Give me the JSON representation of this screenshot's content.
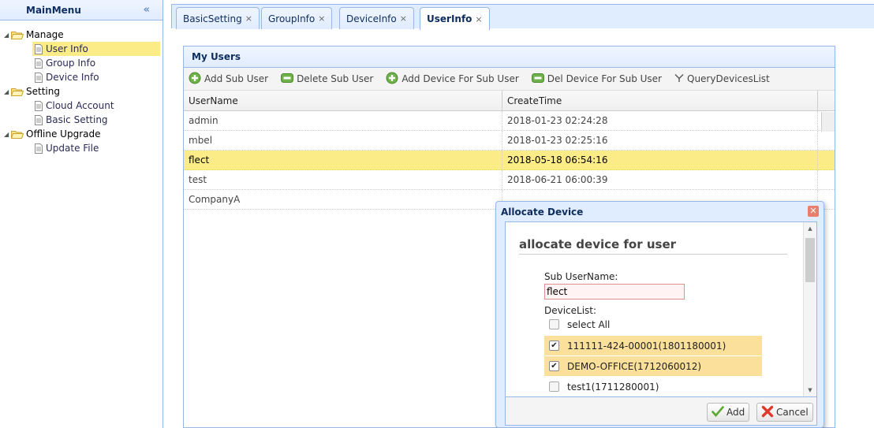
{
  "menu": {
    "title": "MainMenu",
    "collapse_icon": "double-chevron-left-icon",
    "groups": [
      {
        "label": "Manage",
        "items": [
          {
            "label": "User Info",
            "selected": true
          },
          {
            "label": "Group Info"
          },
          {
            "label": "Device Info"
          }
        ]
      },
      {
        "label": "Setting",
        "items": [
          {
            "label": "Cloud Account"
          },
          {
            "label": "Basic Setting"
          }
        ]
      },
      {
        "label": "Offline Upgrade",
        "items": [
          {
            "label": "Update File"
          }
        ]
      }
    ]
  },
  "tabs": [
    {
      "label": "BasicSetting",
      "close": "×"
    },
    {
      "label": "GroupInfo",
      "close": "×"
    },
    {
      "label": "DeviceInfo",
      "close": "×"
    },
    {
      "label": "UserInfo",
      "close": "×",
      "active": true
    }
  ],
  "panel": {
    "title": "My Users",
    "toolbar": {
      "add_sub_user": "Add Sub User",
      "delete_sub_user": "Delete Sub User",
      "add_device": "Add Device For Sub User",
      "del_device": "Del Device For Sub User",
      "query_devices": "QueryDevicesList"
    },
    "columns": [
      "UserName",
      "CreateTime"
    ],
    "rows": [
      {
        "user": "admin",
        "time": "2018-01-23 02:24:28"
      },
      {
        "user": "mbel",
        "time": "2018-01-23 02:25:16"
      },
      {
        "user": "flect",
        "time": "2018-05-18 06:54:16",
        "selected": true
      },
      {
        "user": "test",
        "time": "2018-06-21 06:00:39"
      },
      {
        "user": "CompanyA",
        "time": ""
      }
    ]
  },
  "dialog": {
    "title": "Allocate Device",
    "heading": "allocate device for user",
    "sub_username_label": "Sub UserName:",
    "sub_username_value": "flect",
    "devicelist_label": "DeviceList:",
    "select_all": "select All",
    "devices": [
      {
        "label": "111111-424-00001(1801180001)",
        "checked": true
      },
      {
        "label": "DEMO-OFFICE(1712060012)",
        "checked": true
      },
      {
        "label": "test1(1711280001)",
        "checked": false
      }
    ],
    "add_label": "Add",
    "cancel_label": "Cancel",
    "colors": {
      "header_bg": "#e0ecff",
      "selected_row": "#fbec88",
      "checked_row": "#fbe09b",
      "border": "#95b8e7"
    }
  }
}
